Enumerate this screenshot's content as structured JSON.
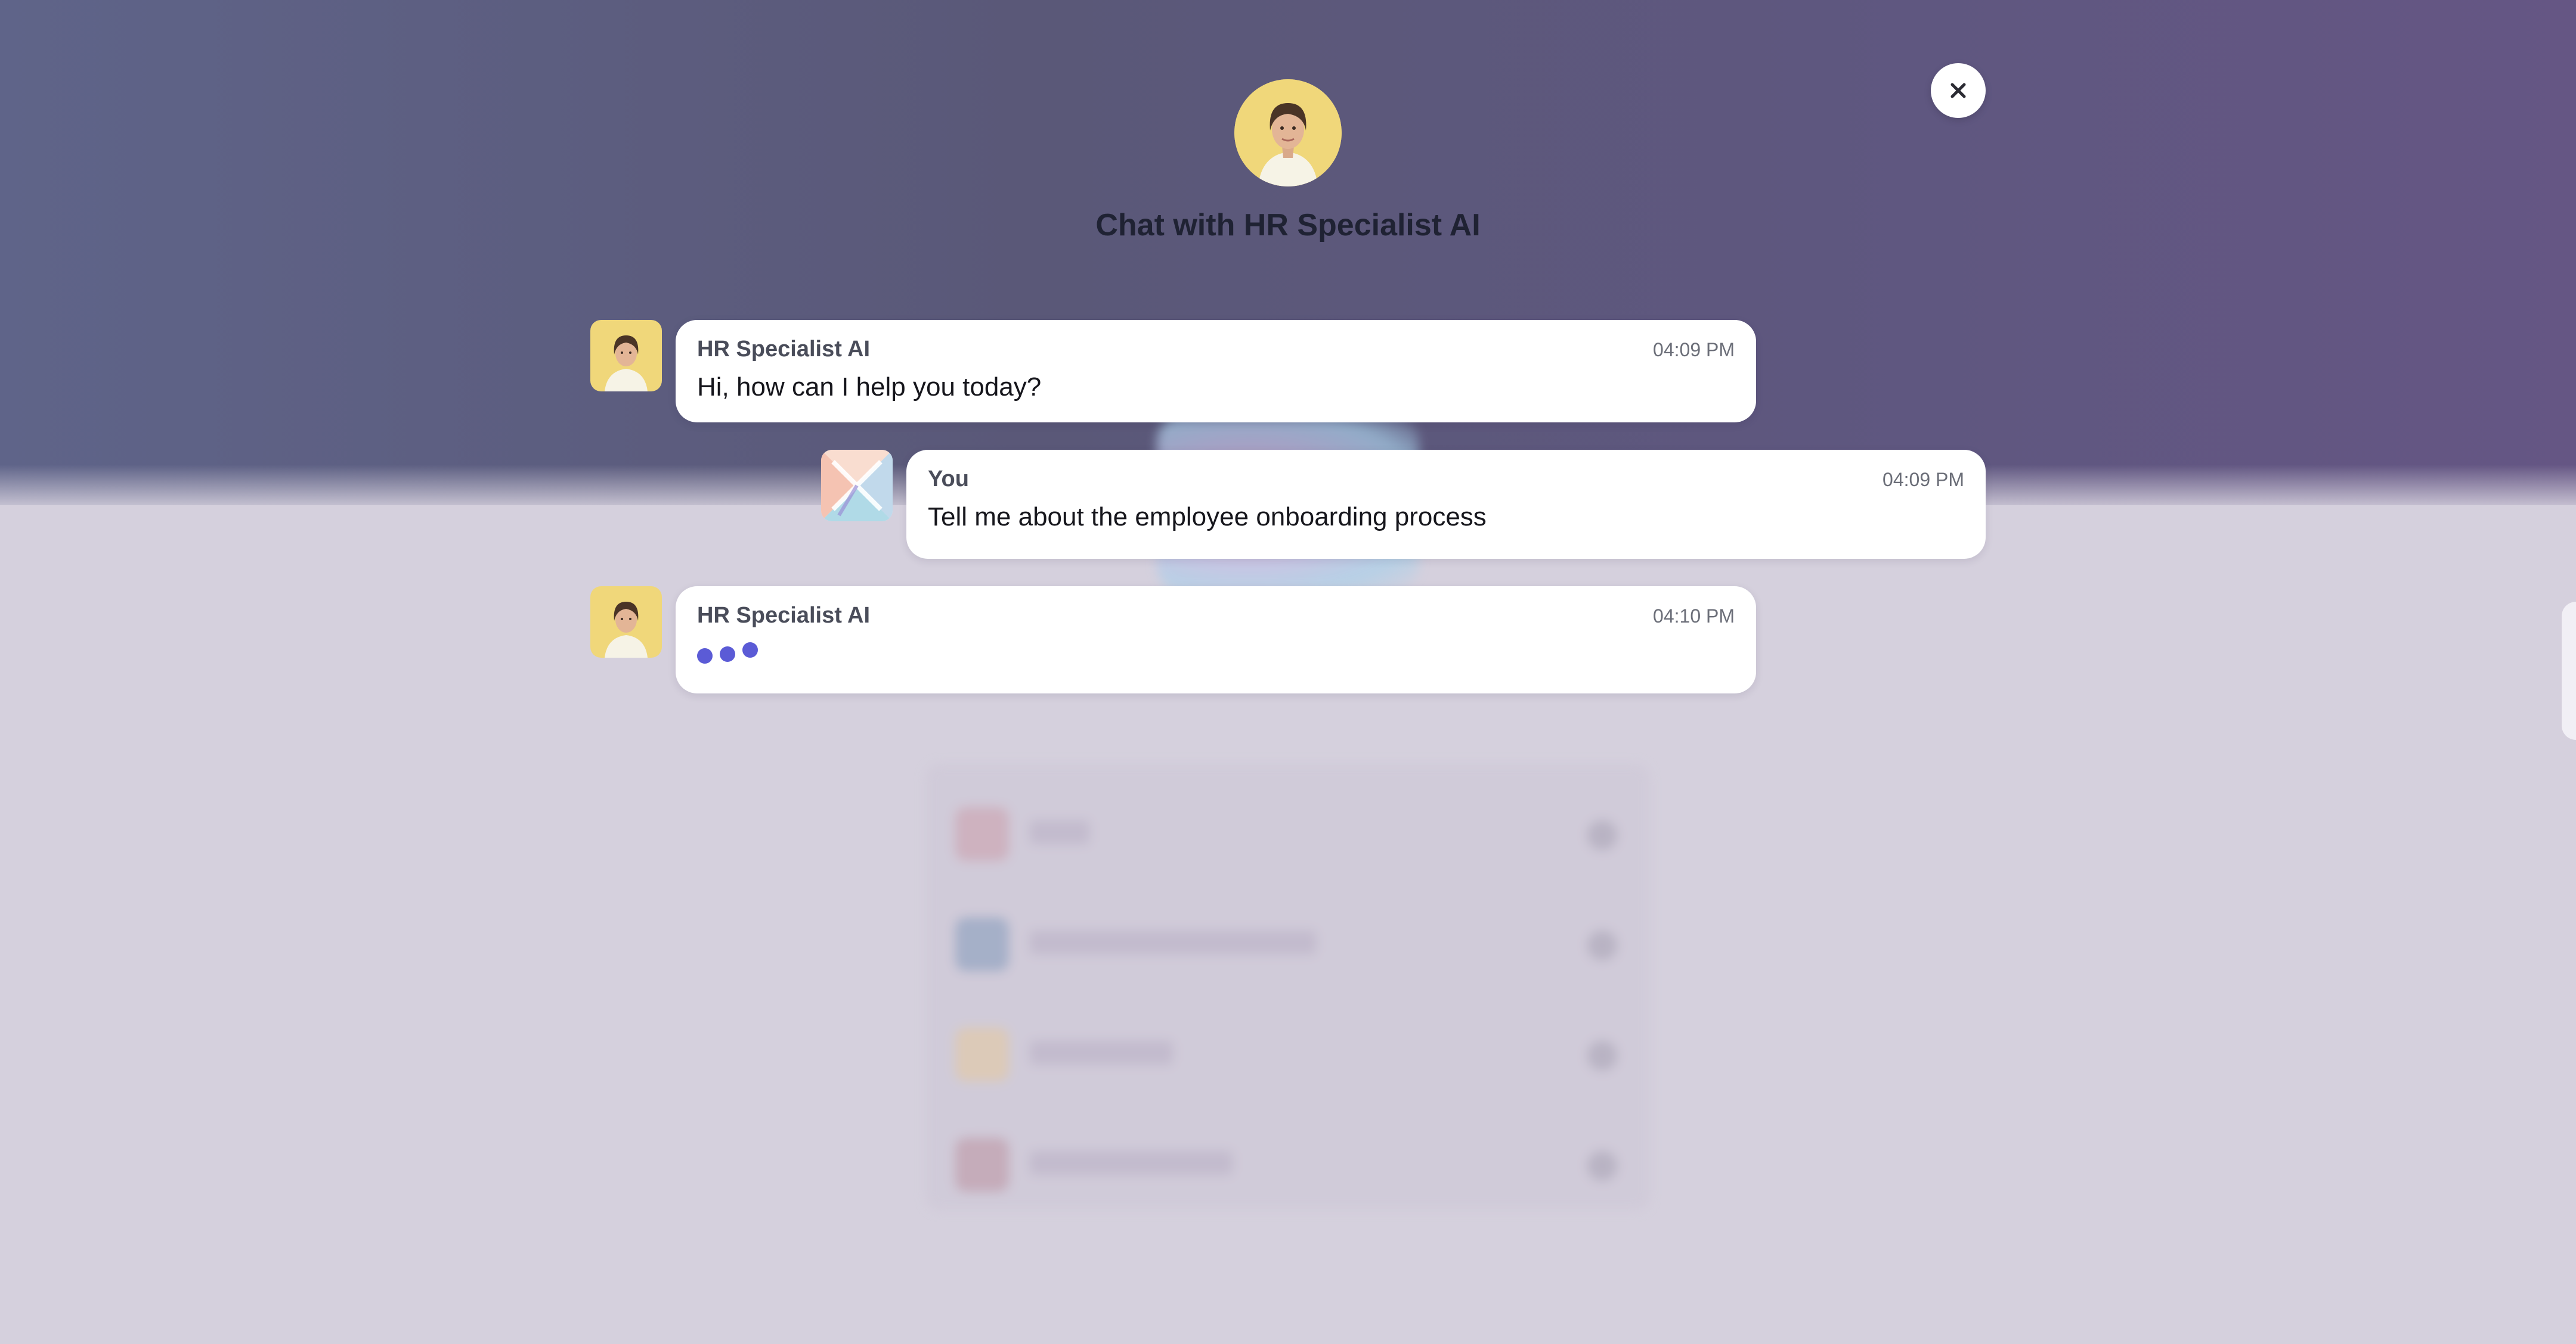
{
  "colors": {
    "accent": "#5b5bd6",
    "header_gradient_start": "#5f6489",
    "header_gradient_end": "#655684",
    "backdrop": "#d5d0dd",
    "bubble": "#ffffff"
  },
  "header": {
    "title": "Chat with HR Specialist AI",
    "avatar_icon": "hr-specialist-avatar",
    "close_icon": "close-icon"
  },
  "messages": [
    {
      "sender": "HR Specialist AI",
      "time": "04:09 PM",
      "text": "Hi, how can I help you today?",
      "avatar_icon": "hr-specialist-avatar"
    },
    {
      "sender": "You",
      "time": "04:09 PM",
      "text": "Tell me about the employee onboarding process",
      "avatar_icon": "user-logo-avatar"
    },
    {
      "sender": "HR Specialist AI",
      "time": "04:10 PM",
      "text": "",
      "typing": true,
      "avatar_icon": "hr-specialist-avatar"
    }
  ]
}
